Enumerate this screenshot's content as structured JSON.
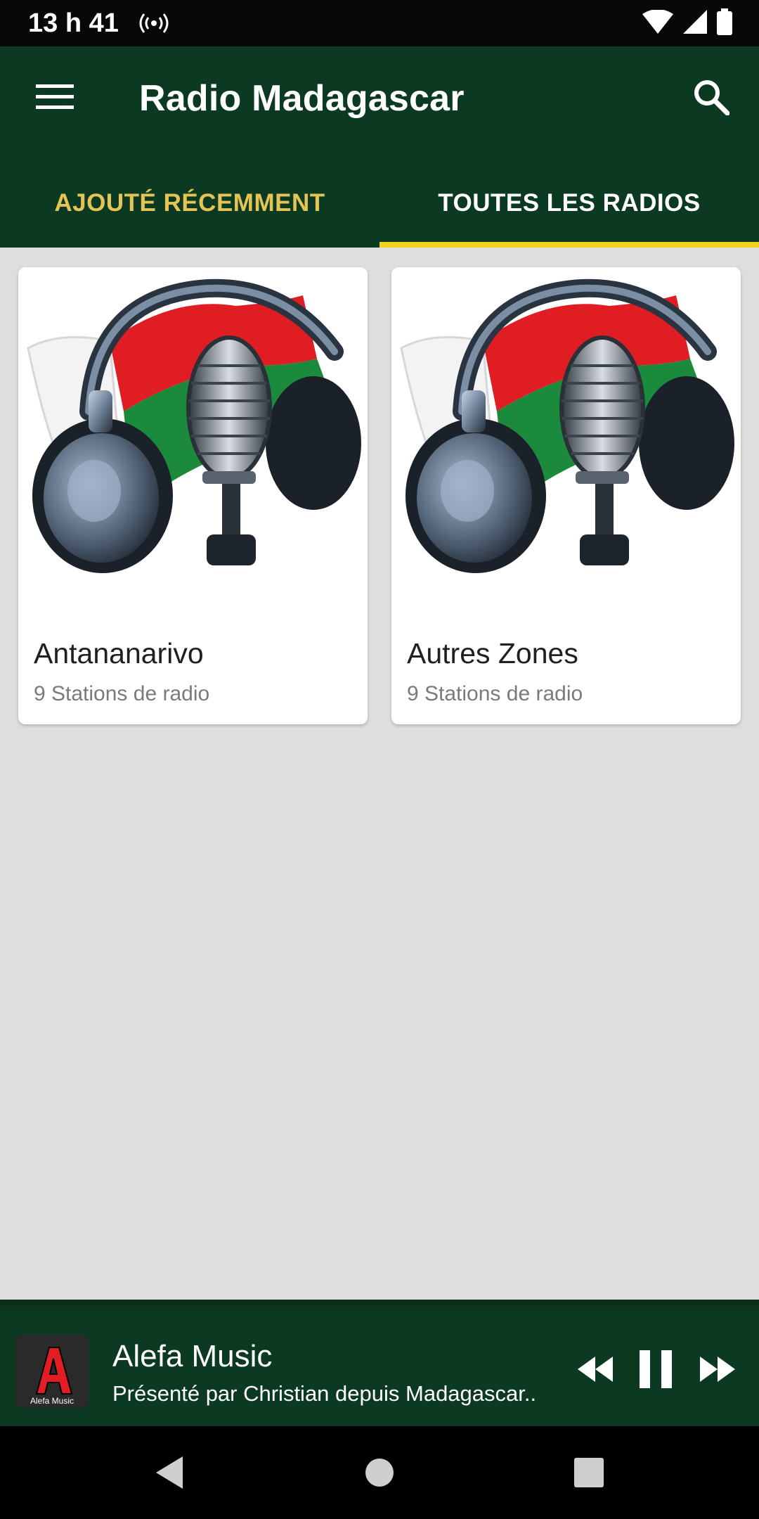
{
  "status_bar": {
    "time": "13 h 41"
  },
  "app_bar": {
    "title": "Radio Madagascar"
  },
  "tabs": [
    {
      "label": "AJOUTÉ RÉCEMMENT",
      "selected": false
    },
    {
      "label": "TOUTES LES RADIOS",
      "selected": true
    }
  ],
  "cards": [
    {
      "title": "Antananarivo",
      "subtitle": "9 Stations de radio"
    },
    {
      "title": "Autres Zones",
      "subtitle": "9 Stations de radio"
    }
  ],
  "player": {
    "station": "Alefa Music",
    "subtitle": "Présenté par Christian depuis Madagascar..",
    "logo_text": "Alefa Music",
    "logo_letter": "A"
  },
  "colors": {
    "app_bar": "#0c3921",
    "tab_indicator": "#f2d21b",
    "tab_inactive_text": "#e3c454",
    "background": "#dfdedf"
  },
  "icons": [
    "menu-icon",
    "search-icon",
    "hotspot-icon",
    "wifi-icon",
    "signal-icon",
    "battery-icon",
    "rewind-icon",
    "pause-icon",
    "fast-forward-icon",
    "back-icon",
    "home-icon",
    "recents-icon"
  ]
}
